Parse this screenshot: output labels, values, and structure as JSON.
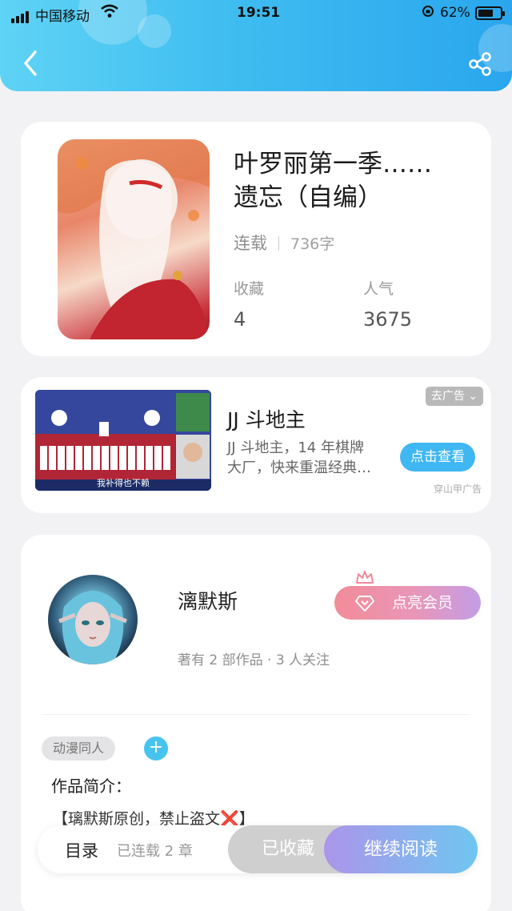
{
  "status_bar": {
    "carrier": "中国移动",
    "time": "19:51",
    "battery": "62%"
  },
  "book": {
    "title_line1": "叶罗丽第一季……",
    "title_line2": "遗忘（自编）",
    "status": "连载",
    "word_count": "736字",
    "favorites_label": "收藏",
    "favorites_value": "4",
    "popularity_label": "人气",
    "popularity_value": "3675"
  },
  "ad": {
    "title": "JJ 斗地主",
    "desc_line1": "JJ 斗地主，14 年棋牌",
    "desc_line2": "大厂，快来重温经典…",
    "remove_label": "去广告",
    "cta_label": "点击查看",
    "source": "穿山甲广告",
    "image_caption": "我补得也不赖"
  },
  "author": {
    "name": "漓默斯",
    "vip_label": "点亮会员",
    "meta": "著有 2 部作品 · 3 人关注",
    "tag": "动漫同人",
    "add_tag": "+",
    "intro_label": "作品简介：",
    "intro_text": "【璃默斯原创，禁止盗文",
    "intro_mark": "❌",
    "intro_end": "】"
  },
  "bottom_bar": {
    "toc_label": "目录",
    "chapters": "已连载 2 章",
    "collected_label": "已收藏",
    "continue_label": "继续阅读"
  },
  "colors": {
    "header_gradient_start": "#5fd3f5",
    "header_gradient_end": "#2aa6ee",
    "accent_blue": "#3fb7f2",
    "vip_pink": "#f28c98",
    "continue_purple": "#ac95ea"
  }
}
